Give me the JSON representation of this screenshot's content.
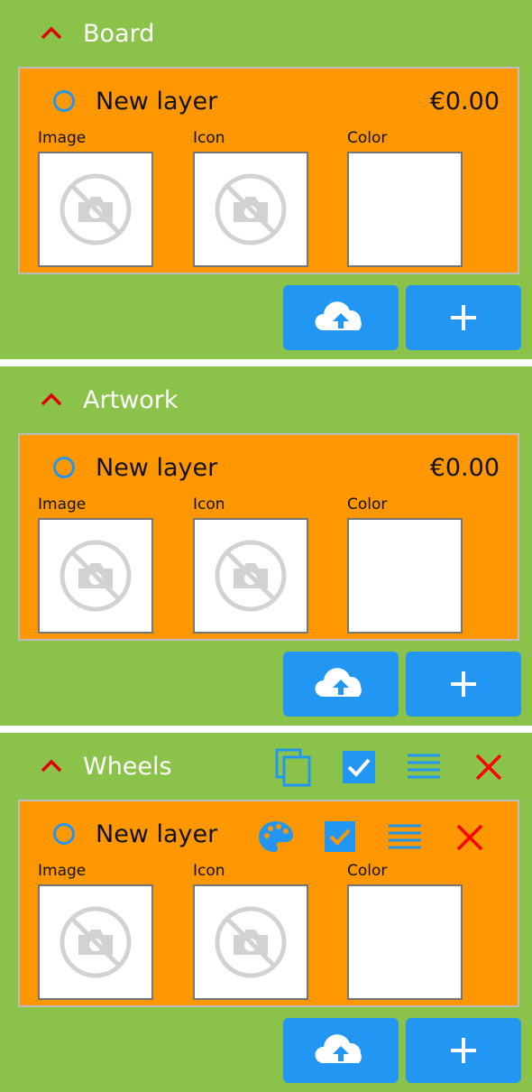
{
  "sections": [
    {
      "title": "Board",
      "layer": {
        "name": "New layer",
        "price": "€0.00"
      }
    },
    {
      "title": "Artwork",
      "layer": {
        "name": "New layer",
        "price": "€0.00"
      }
    },
    {
      "title": "Wheels",
      "layer": {
        "name": "New layer"
      }
    }
  ],
  "labels": {
    "image": "Image",
    "icon": "Icon",
    "color": "Color"
  },
  "section_toolbar_icons": [
    "copy-icon",
    "checkbox-checked-icon",
    "list-icon",
    "close-icon"
  ],
  "layer_toolbar_icons": [
    "palette-icon",
    "checkbox-checked-icon",
    "list-icon",
    "close-icon"
  ],
  "colors": {
    "section_bg": "#8bc34a",
    "card_bg": "#ff9800",
    "accent_blue": "#2196f3",
    "red": "#ff0000",
    "chevron_red": "#e00000"
  }
}
